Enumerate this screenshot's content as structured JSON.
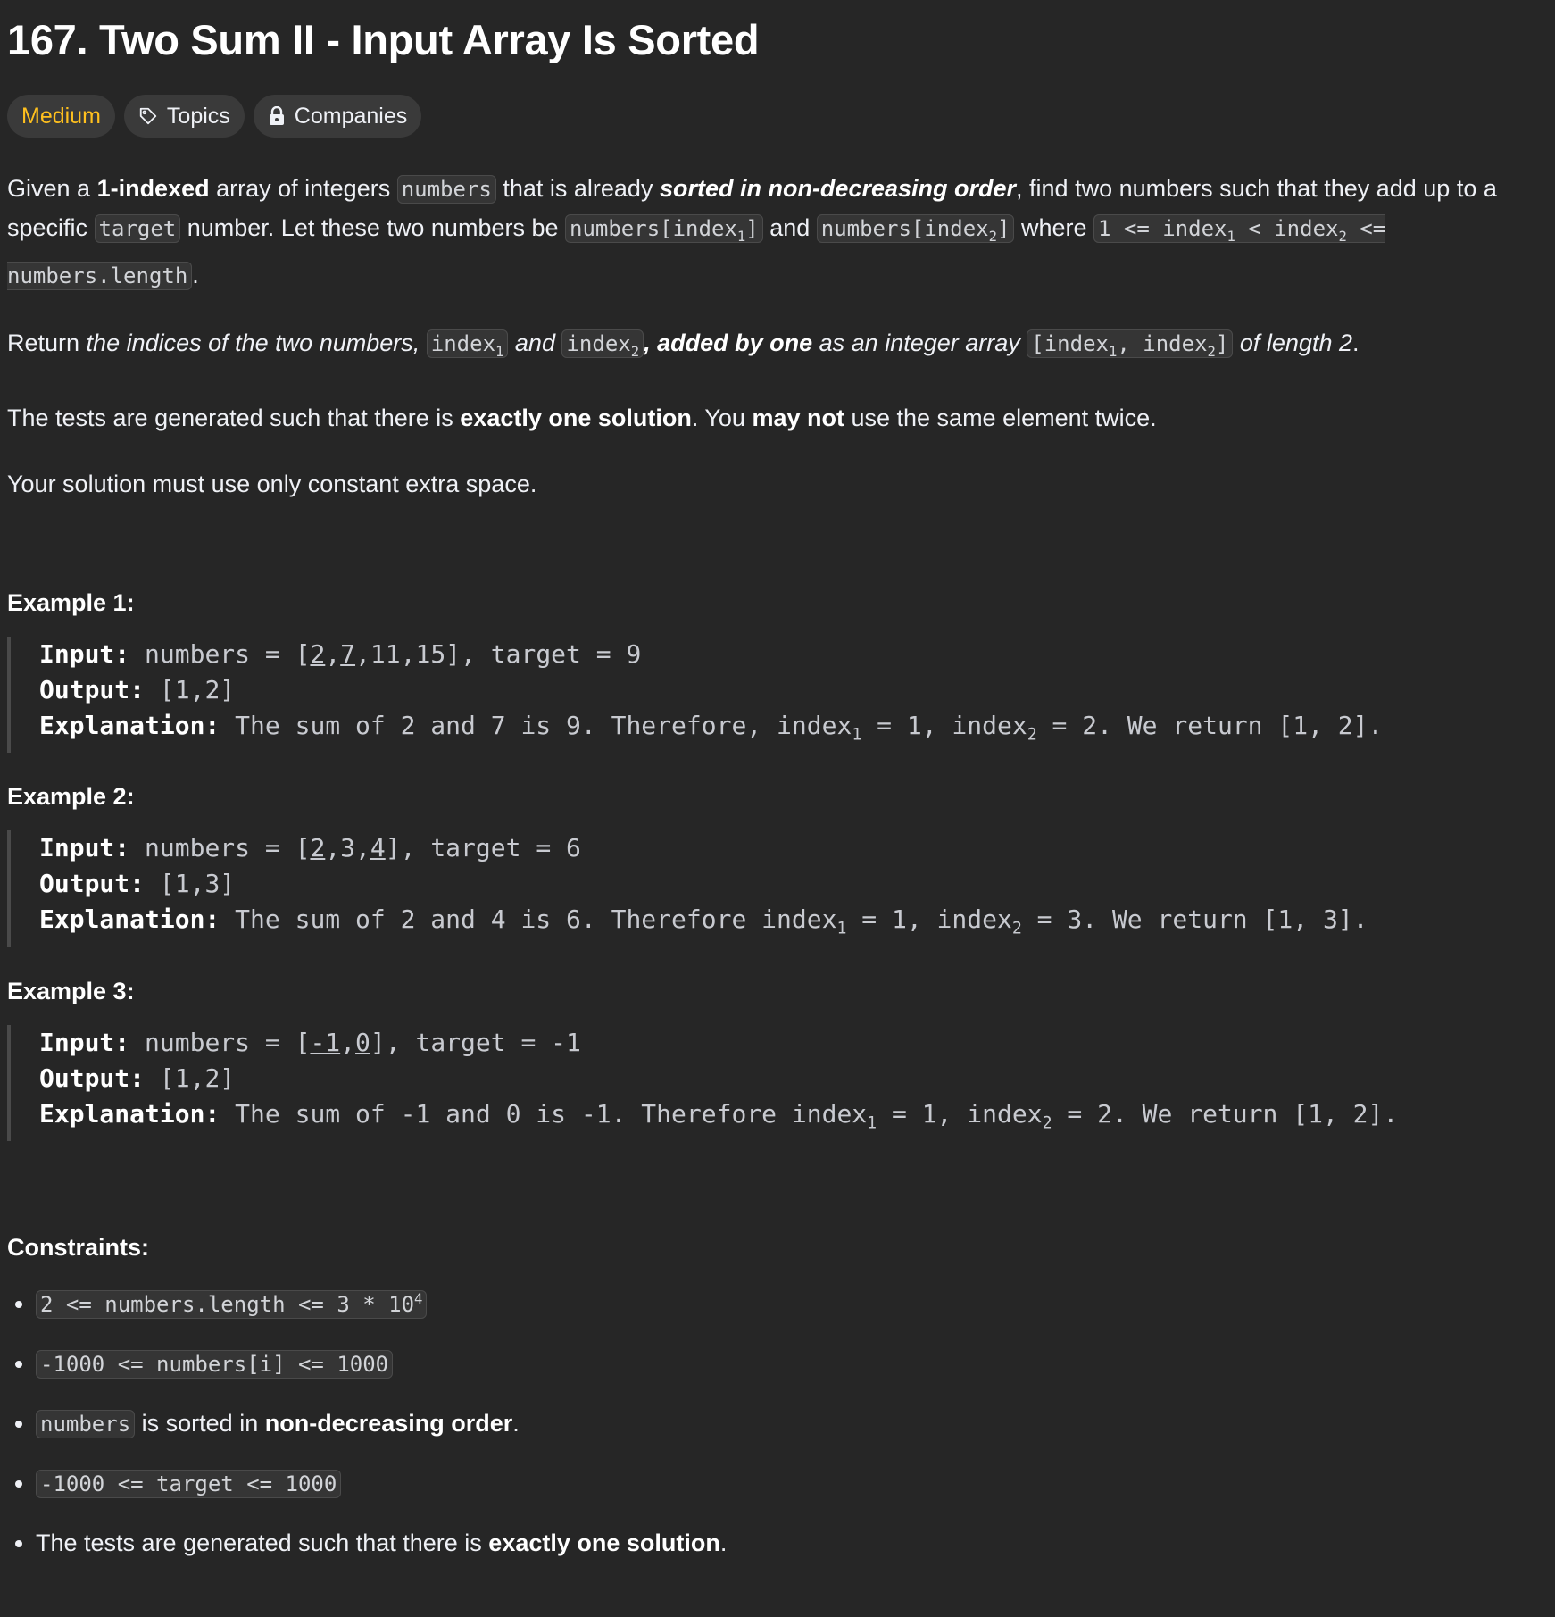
{
  "title": "167. Two Sum II - Input Array Is Sorted",
  "tags": {
    "difficulty": "Medium",
    "topics": "Topics",
    "companies": "Companies"
  },
  "description": {
    "p1": {
      "t1": "Given a ",
      "b1": "1-indexed",
      "t2": " array of integers ",
      "c1": "numbers",
      "t3": " that is already ",
      "bi1": "sorted in non-decreasing order",
      "t4": ", find two numbers such that they add up to a specific ",
      "c2": "target",
      "t5": " number. Let these two numbers be ",
      "c3a": "numbers[index",
      "c3sub": "1",
      "c3b": "]",
      "t6": " and ",
      "c4a": "numbers[index",
      "c4sub": "2",
      "c4b": "]",
      "t7": " where ",
      "c5a": "1 <= index",
      "c5sub1": "1",
      "c5b": " < index",
      "c5sub2": "2",
      "c5c": " <= numbers.length",
      "t8": "."
    },
    "p2": {
      "t1": "Return ",
      "i1": "the indices of the two numbers, ",
      "c1a": "index",
      "c1sub": "1",
      "i2": " and ",
      "c2a": "index",
      "c2sub": "2",
      "bi1": ", added by one",
      "i3": " as an integer array ",
      "c3a": "[index",
      "c3sub1": "1",
      "c3b": ", index",
      "c3sub2": "2",
      "c3c": "]",
      "i4": " of length 2",
      "t2": "."
    },
    "p3": {
      "t1": "The tests are generated such that there is ",
      "b1": "exactly one solution",
      "t2": ". You ",
      "b2": "may not",
      "t3": " use the same element twice."
    },
    "p4": "Your solution must use only constant extra space."
  },
  "examples": [
    {
      "title": "Example 1:",
      "input_label": "Input:",
      "output_label": "Output:",
      "expl_label": "Explanation:",
      "input_pre": " numbers = [",
      "input_v1": "2",
      "input_sep1": ",",
      "input_v2": "7",
      "input_post": ",11,15], target = 9",
      "output": " [1,2]",
      "expl_a": " The sum of 2 and 7 is 9. Therefore, index",
      "expl_sub1": "1",
      "expl_b": " = 1, index",
      "expl_sub2": "2",
      "expl_c": " = 2. We return [1, 2]."
    },
    {
      "title": "Example 2:",
      "input_label": "Input:",
      "output_label": "Output:",
      "expl_label": "Explanation:",
      "input_pre": " numbers = [",
      "input_v1": "2",
      "input_sep1": ",3,",
      "input_v2": "4",
      "input_post": "], target = 6",
      "output": " [1,3]",
      "expl_a": " The sum of 2 and 4 is 6. Therefore index",
      "expl_sub1": "1",
      "expl_b": " = 1, index",
      "expl_sub2": "2",
      "expl_c": " = 3. We return [1, 3]."
    },
    {
      "title": "Example 3:",
      "input_label": "Input:",
      "output_label": "Output:",
      "expl_label": "Explanation:",
      "input_pre": " numbers = [",
      "input_v1": "-1",
      "input_sep1": ",",
      "input_v2": "0",
      "input_post": "], target = -1",
      "output": " [1,2]",
      "expl_a": " The sum of -1 and 0 is -1. Therefore index",
      "expl_sub1": "1",
      "expl_b": " = 1, index",
      "expl_sub2": "2",
      "expl_c": " = 2. We return [1, 2]."
    }
  ],
  "constraints": {
    "title": "Constraints:",
    "c1a": "2 <= numbers.length <= 3 * 10",
    "c1sup": "4",
    "c2": "-1000 <= numbers[i] <= 1000",
    "c3code": "numbers",
    "c3t1": " is sorted in ",
    "c3b": "non-decreasing order",
    "c3t2": ".",
    "c4": "-1000 <= target <= 1000",
    "c5t1": "The tests are generated such that there is ",
    "c5b": "exactly one solution",
    "c5t2": "."
  },
  "colors": {
    "background": "#262626",
    "difficulty_medium": "#ffc01e",
    "tag_background": "#3a3a3a"
  }
}
